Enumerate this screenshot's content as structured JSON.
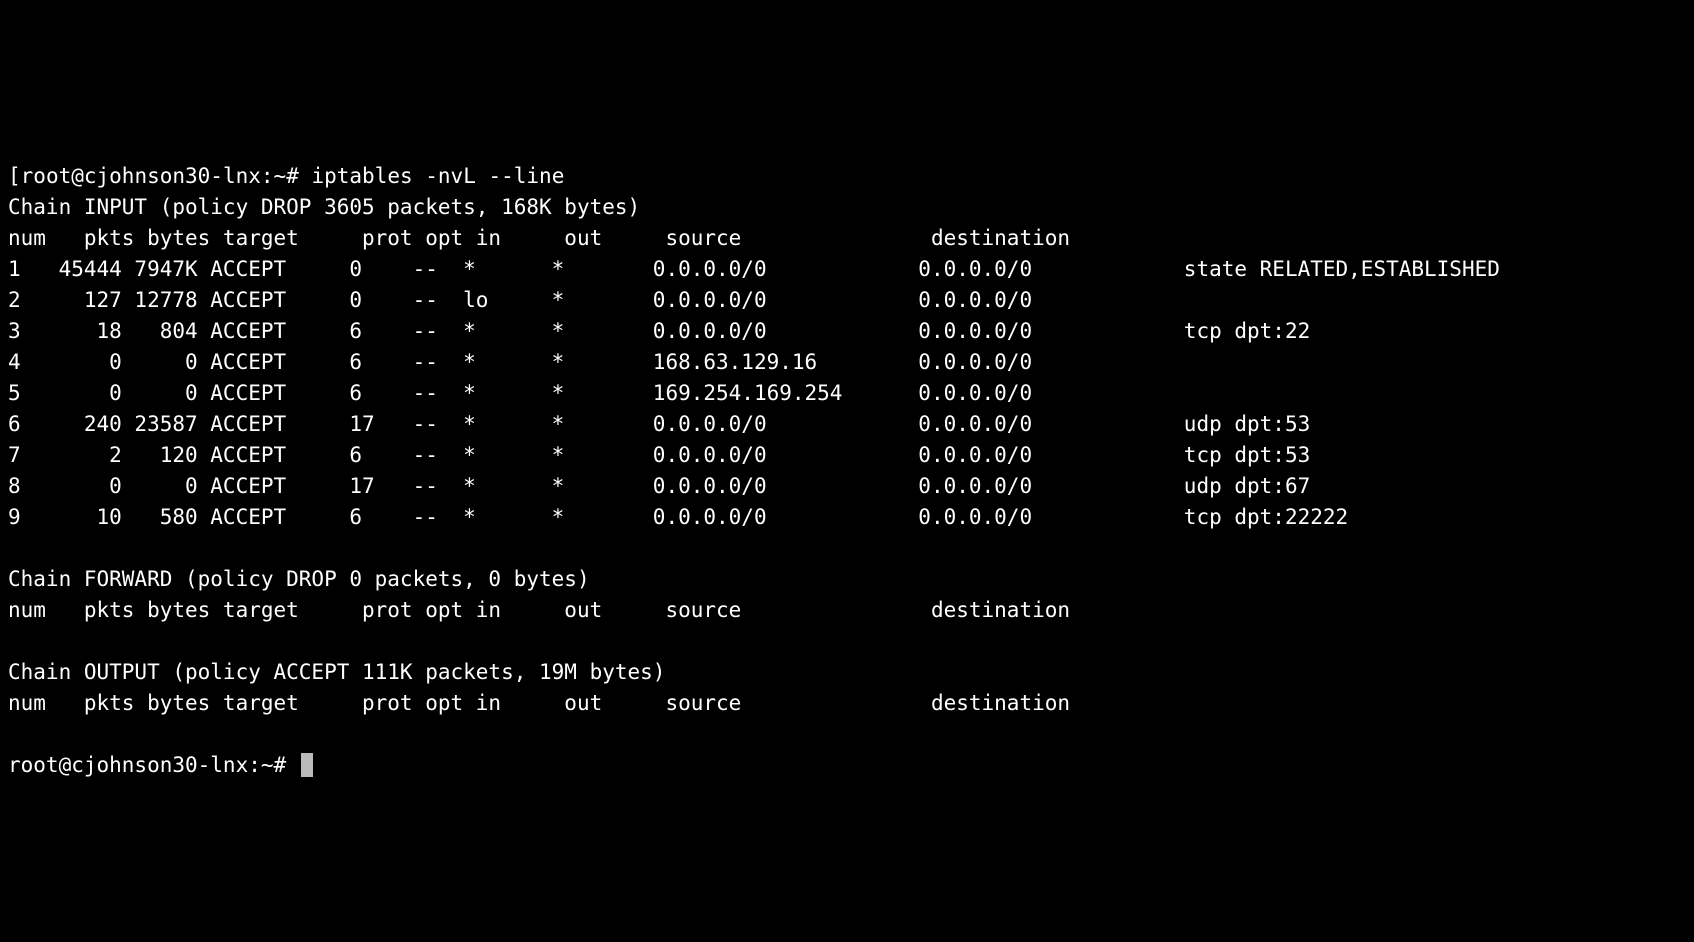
{
  "prompt1_prefix": "[",
  "prompt_user_host": "root@cjohnson30-lnx",
  "prompt_sep": ":",
  "prompt_path": "~",
  "prompt_mark": "# ",
  "command": "iptables -nvL --line",
  "chains": [
    {
      "header": "Chain INPUT (policy DROP 3605 packets, 168K bytes)",
      "cols": "num   pkts bytes target     prot opt in     out     source               destination",
      "rows": [
        {
          "num": "1",
          "pkts": "45444",
          "bytes": "7947K",
          "target": "ACCEPT",
          "prot": "0",
          "opt": "--",
          "in": "*",
          "out": "*",
          "source": "0.0.0.0/0",
          "destination": "0.0.0.0/0",
          "extra": "state RELATED,ESTABLISHED"
        },
        {
          "num": "2",
          "pkts": "127",
          "bytes": "12778",
          "target": "ACCEPT",
          "prot": "0",
          "opt": "--",
          "in": "lo",
          "out": "*",
          "source": "0.0.0.0/0",
          "destination": "0.0.0.0/0",
          "extra": ""
        },
        {
          "num": "3",
          "pkts": "18",
          "bytes": "804",
          "target": "ACCEPT",
          "prot": "6",
          "opt": "--",
          "in": "*",
          "out": "*",
          "source": "0.0.0.0/0",
          "destination": "0.0.0.0/0",
          "extra": "tcp dpt:22"
        },
        {
          "num": "4",
          "pkts": "0",
          "bytes": "0",
          "target": "ACCEPT",
          "prot": "6",
          "opt": "--",
          "in": "*",
          "out": "*",
          "source": "168.63.129.16",
          "destination": "0.0.0.0/0",
          "extra": ""
        },
        {
          "num": "5",
          "pkts": "0",
          "bytes": "0",
          "target": "ACCEPT",
          "prot": "6",
          "opt": "--",
          "in": "*",
          "out": "*",
          "source": "169.254.169.254",
          "destination": "0.0.0.0/0",
          "extra": ""
        },
        {
          "num": "6",
          "pkts": "240",
          "bytes": "23587",
          "target": "ACCEPT",
          "prot": "17",
          "opt": "--",
          "in": "*",
          "out": "*",
          "source": "0.0.0.0/0",
          "destination": "0.0.0.0/0",
          "extra": "udp dpt:53"
        },
        {
          "num": "7",
          "pkts": "2",
          "bytes": "120",
          "target": "ACCEPT",
          "prot": "6",
          "opt": "--",
          "in": "*",
          "out": "*",
          "source": "0.0.0.0/0",
          "destination": "0.0.0.0/0",
          "extra": "tcp dpt:53"
        },
        {
          "num": "8",
          "pkts": "0",
          "bytes": "0",
          "target": "ACCEPT",
          "prot": "17",
          "opt": "--",
          "in": "*",
          "out": "*",
          "source": "0.0.0.0/0",
          "destination": "0.0.0.0/0",
          "extra": "udp dpt:67"
        },
        {
          "num": "9",
          "pkts": "10",
          "bytes": "580",
          "target": "ACCEPT",
          "prot": "6",
          "opt": "--",
          "in": "*",
          "out": "*",
          "source": "0.0.0.0/0",
          "destination": "0.0.0.0/0",
          "extra": "tcp dpt:22222"
        }
      ]
    },
    {
      "header": "Chain FORWARD (policy DROP 0 packets, 0 bytes)",
      "cols": "num   pkts bytes target     prot opt in     out     source               destination",
      "rows": []
    },
    {
      "header": "Chain OUTPUT (policy ACCEPT 111K packets, 19M bytes)",
      "cols": "num   pkts bytes target     prot opt in     out     source               destination",
      "rows": []
    }
  ],
  "prompt2_user_host": "root@cjohnson30-lnx",
  "prompt2_path": "~"
}
